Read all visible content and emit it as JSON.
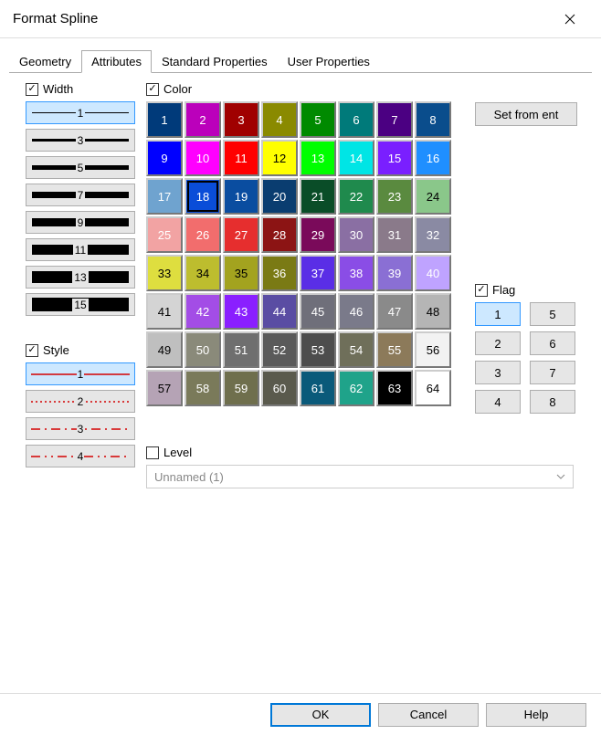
{
  "window": {
    "title": "Format Spline"
  },
  "tabs": [
    {
      "label": "Geometry",
      "selected": false
    },
    {
      "label": "Attributes",
      "selected": true
    },
    {
      "label": "Standard Properties",
      "selected": false
    },
    {
      "label": "User Properties",
      "selected": false
    }
  ],
  "width_section": {
    "label": "Width",
    "checked": true,
    "items": [
      {
        "num": "1",
        "thickness": 1,
        "selected": true
      },
      {
        "num": "3",
        "thickness": 3,
        "selected": false
      },
      {
        "num": "5",
        "thickness": 5,
        "selected": false
      },
      {
        "num": "7",
        "thickness": 7,
        "selected": false
      },
      {
        "num": "9",
        "thickness": 9,
        "selected": false
      },
      {
        "num": "11",
        "thickness": 11,
        "selected": false
      },
      {
        "num": "13",
        "thickness": 13,
        "selected": false
      },
      {
        "num": "15",
        "thickness": 15,
        "selected": false
      }
    ]
  },
  "style_section": {
    "label": "Style",
    "checked": true,
    "items": [
      {
        "num": "1",
        "dash": "",
        "selected": true
      },
      {
        "num": "2",
        "dash": "2,3",
        "selected": false
      },
      {
        "num": "3",
        "dash": "10,5,2,5",
        "selected": false
      },
      {
        "num": "4",
        "dash": "10,5,2,5,2,5",
        "selected": false
      }
    ],
    "stroke": "#d40000"
  },
  "color_section": {
    "label": "Color",
    "checked": true,
    "selected": 18,
    "swatches": [
      {
        "n": 1,
        "c": "#003a7a",
        "dark": false
      },
      {
        "n": 2,
        "c": "#bb00bb",
        "dark": false
      },
      {
        "n": 3,
        "c": "#a00000",
        "dark": false
      },
      {
        "n": 4,
        "c": "#8a8a00",
        "dark": false
      },
      {
        "n": 5,
        "c": "#008a00",
        "dark": false
      },
      {
        "n": 6,
        "c": "#007a7a",
        "dark": false
      },
      {
        "n": 7,
        "c": "#4b0082",
        "dark": false
      },
      {
        "n": 8,
        "c": "#0a4d8c",
        "dark": false
      },
      {
        "n": 9,
        "c": "#0000ff",
        "dark": false
      },
      {
        "n": 10,
        "c": "#ff00ff",
        "dark": false
      },
      {
        "n": 11,
        "c": "#ff0000",
        "dark": false
      },
      {
        "n": 12,
        "c": "#ffff00",
        "dark": true
      },
      {
        "n": 13,
        "c": "#00ff00",
        "dark": false
      },
      {
        "n": 14,
        "c": "#00e5e5",
        "dark": false
      },
      {
        "n": 15,
        "c": "#7a1fff",
        "dark": false
      },
      {
        "n": 16,
        "c": "#1f8fff",
        "dark": false
      },
      {
        "n": 17,
        "c": "#6fa3cf",
        "dark": false
      },
      {
        "n": 18,
        "c": "#0a4dd8",
        "dark": false
      },
      {
        "n": 19,
        "c": "#0a4da0",
        "dark": false
      },
      {
        "n": 20,
        "c": "#0a3d70",
        "dark": false
      },
      {
        "n": 21,
        "c": "#0a4d28",
        "dark": false
      },
      {
        "n": 22,
        "c": "#1f8a4d",
        "dark": false
      },
      {
        "n": 23,
        "c": "#5a8a3f",
        "dark": false
      },
      {
        "n": 24,
        "c": "#8ac78a",
        "dark": true
      },
      {
        "n": 25,
        "c": "#f2a3a3",
        "dark": false
      },
      {
        "n": 26,
        "c": "#f26d6d",
        "dark": false
      },
      {
        "n": 27,
        "c": "#e62e2e",
        "dark": false
      },
      {
        "n": 28,
        "c": "#8c1414",
        "dark": false
      },
      {
        "n": 29,
        "c": "#7a0a5a",
        "dark": false
      },
      {
        "n": 30,
        "c": "#8a6fa3",
        "dark": false
      },
      {
        "n": 31,
        "c": "#8a7a8a",
        "dark": false
      },
      {
        "n": 32,
        "c": "#8a8aa3",
        "dark": false
      },
      {
        "n": 33,
        "c": "#dede3f",
        "dark": true
      },
      {
        "n": 34,
        "c": "#bdbd2e",
        "dark": true
      },
      {
        "n": 35,
        "c": "#a3a31f",
        "dark": true
      },
      {
        "n": 36,
        "c": "#7a7a14",
        "dark": false
      },
      {
        "n": 37,
        "c": "#5a2ee6",
        "dark": false
      },
      {
        "n": 38,
        "c": "#8a4de6",
        "dark": false
      },
      {
        "n": 39,
        "c": "#8a6fd4",
        "dark": false
      },
      {
        "n": 40,
        "c": "#bfa3ff",
        "dark": false
      },
      {
        "n": 41,
        "c": "#d4d4d4",
        "dark": true
      },
      {
        "n": 42,
        "c": "#a34de6",
        "dark": false
      },
      {
        "n": 43,
        "c": "#8a1fff",
        "dark": false
      },
      {
        "n": 44,
        "c": "#5a4da3",
        "dark": false
      },
      {
        "n": 45,
        "c": "#6f6f7a",
        "dark": false
      },
      {
        "n": 46,
        "c": "#7a7a8a",
        "dark": false
      },
      {
        "n": 47,
        "c": "#8a8a8a",
        "dark": false
      },
      {
        "n": 48,
        "c": "#b5b5b5",
        "dark": true
      },
      {
        "n": 49,
        "c": "#bfbfbf",
        "dark": true
      },
      {
        "n": 50,
        "c": "#8a8a7a",
        "dark": false
      },
      {
        "n": 51,
        "c": "#6f6f6f",
        "dark": false
      },
      {
        "n": 52,
        "c": "#5a5a5a",
        "dark": false
      },
      {
        "n": 53,
        "c": "#4d4d4d",
        "dark": false
      },
      {
        "n": 54,
        "c": "#6f6f5a",
        "dark": false
      },
      {
        "n": 55,
        "c": "#8c7a5a",
        "dark": false
      },
      {
        "n": 56,
        "c": "#f2f2f2",
        "dark": true
      },
      {
        "n": 57,
        "c": "#b5a3b5",
        "dark": true
      },
      {
        "n": 58,
        "c": "#7a7a5a",
        "dark": false
      },
      {
        "n": 59,
        "c": "#6f6f4d",
        "dark": false
      },
      {
        "n": 60,
        "c": "#5a5a4d",
        "dark": false
      },
      {
        "n": 61,
        "c": "#0a5a7a",
        "dark": false
      },
      {
        "n": 62,
        "c": "#1fa38a",
        "dark": false
      },
      {
        "n": 63,
        "c": "#000000",
        "dark": false
      },
      {
        "n": 64,
        "c": "#ffffff",
        "dark": true
      }
    ]
  },
  "level_section": {
    "label": "Level",
    "checked": false,
    "value": "Unnamed (1)"
  },
  "set_from_ent": {
    "label": "Set from ent"
  },
  "flag_section": {
    "label": "Flag",
    "checked": true,
    "selected": 1,
    "items": [
      "1",
      "5",
      "2",
      "6",
      "3",
      "7",
      "4",
      "8"
    ]
  },
  "footer": {
    "ok": "OK",
    "cancel": "Cancel",
    "help": "Help"
  }
}
